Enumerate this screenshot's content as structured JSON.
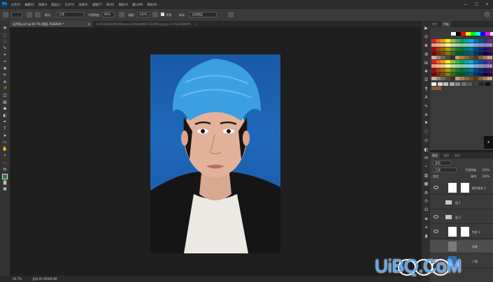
{
  "app": {
    "logo": "Ps"
  },
  "menu": [
    "文件(F)",
    "编辑(E)",
    "图像(I)",
    "图层(L)",
    "文字(Y)",
    "选择(S)",
    "滤镜(T)",
    "3D(D)",
    "视图(V)",
    "窗口(W)",
    "帮助(H)"
  ],
  "window_buttons": [
    "—",
    "☐",
    "✕"
  ],
  "options_bar": {
    "mode_label": "模式:",
    "mode_value": "正常",
    "opacity_label": "不透明度:",
    "opacity_value": "90%",
    "flow_label": "流量:",
    "flow_value": "100%",
    "smooth_label": "平滑",
    "sample_label": "样本:",
    "sample_value": "当前图层"
  },
  "tabs": [
    {
      "label": "证件照.psd @ 20.7% (图层, RGB/8#) *",
      "active": true
    },
    {
      "label": "fcc6130ebaf9b4f3bacea3168eb9641732890.jpg @ 11.6%(RGB/8#)",
      "active": false
    }
  ],
  "status": {
    "zoom": "20.7%",
    "doc": "文档:26.2M/88.9M"
  },
  "swatches_panel": {
    "tabs": [
      "颜色",
      "色板"
    ]
  },
  "swatches": {
    "row0": [
      "#ffffff",
      "#000000",
      "#ff0000",
      "#ffff00",
      "#00ff00",
      "#00ffff",
      "#0000ff",
      "#ff00ff",
      "#ffffff"
    ],
    "grid_colors": [
      "#ed1c24",
      "#f26522",
      "#f7941d",
      "#fff200",
      "#8dc63f",
      "#39b54a",
      "#00a651",
      "#00a99d",
      "#00aeef",
      "#0072bc",
      "#0054a6",
      "#2e3192",
      "#662d91",
      "#f69679",
      "#f9ad81",
      "#fdc689",
      "#fff799",
      "#c4df9b",
      "#a3d39c",
      "#82ca9c",
      "#7accc8",
      "#6dcff6",
      "#7da7d9",
      "#8393ca",
      "#8781bd",
      "#a186be",
      "#9e0b0f",
      "#a0410d",
      "#a36209",
      "#aba000",
      "#598527",
      "#1a7b30",
      "#007236",
      "#00746b",
      "#0076a3",
      "#004b80",
      "#003471",
      "#1b1464",
      "#440e62",
      "#790000",
      "#7b2e00",
      "#7d4900",
      "#827b00",
      "#406618",
      "#005e20",
      "#005826",
      "#005952",
      "#005b7f",
      "#003663",
      "#002157",
      "#0d004c",
      "#32004b",
      "#c7b299",
      "#998675",
      "#736357",
      "#534741",
      "#37302a",
      "#c69c6d",
      "#a67c52",
      "#8c6239",
      "#754c24",
      "#603913",
      "#8b5e3c",
      "#a67d59",
      "#c8a47e"
    ],
    "gray_ramp": [
      "#f2f2f2",
      "#d9d9d9",
      "#bfbfbf",
      "#a6a6a6",
      "#8c8c8c",
      "#737373",
      "#595959",
      "#404040",
      "#262626",
      "#111111"
    ],
    "brown": [
      "#8b5a2b",
      "#a0522d"
    ]
  },
  "layers_panel": {
    "tabs": [
      "图层",
      "通道",
      "路径"
    ],
    "filter_label": "类型",
    "blend_mode": "正常",
    "opacity_label": "不透明度:",
    "opacity_value": "100%",
    "lock_label": "锁定:",
    "fill_label": "填充:",
    "fill_value": "100%",
    "layers": [
      {
        "name": "颜色填充 1",
        "selected": false,
        "visible": true,
        "thumb": "#ffffff"
      },
      {
        "name": "组 1",
        "selected": false,
        "visible": false,
        "thumb": ""
      },
      {
        "name": "组 2",
        "selected": false,
        "visible": true,
        "thumb": ""
      },
      {
        "name": "色阶 1",
        "selected": false,
        "visible": true,
        "thumb": "#ffffff"
      },
      {
        "name": "背景",
        "selected": true,
        "visible": false,
        "thumb": "#7a7a7a"
      },
      {
        "name": "人物",
        "selected": false,
        "visible": true,
        "thumb": "#2f6fb3"
      }
    ]
  },
  "watermark": {
    "text": "UiBQ.CoM"
  }
}
